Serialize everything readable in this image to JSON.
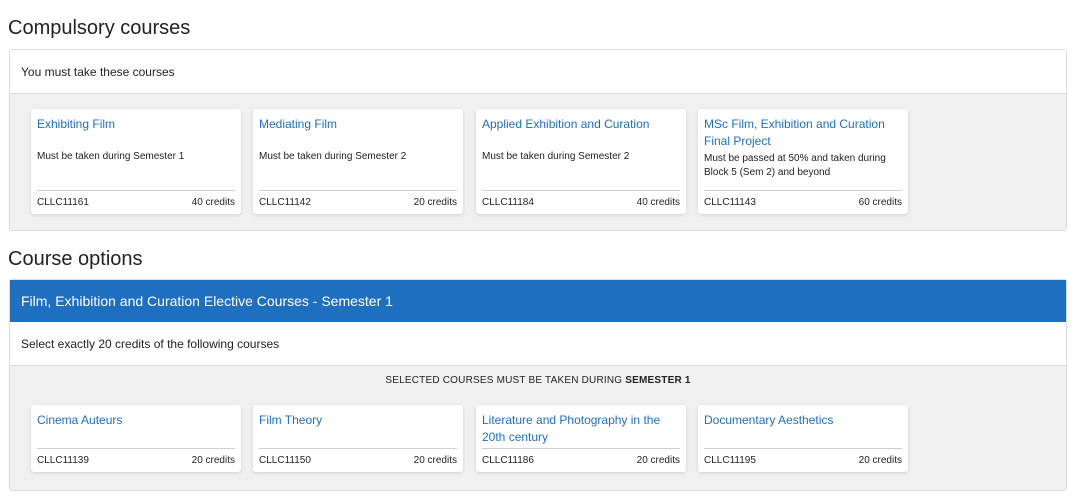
{
  "compulsory": {
    "title": "Compulsory courses",
    "subtitle": "You must take these courses",
    "courses": [
      {
        "title": "Exhibiting Film",
        "desc": "Must be taken during Semester 1",
        "code": "CLLC11161",
        "credits": "40 credits"
      },
      {
        "title": "Mediating Film",
        "desc": "Must be taken during Semester 2",
        "code": "CLLC11142",
        "credits": "20 credits"
      },
      {
        "title": "Applied Exhibition and Curation",
        "desc": "Must be taken during Semester 2",
        "code": "CLLC11184",
        "credits": "40 credits"
      },
      {
        "title": "MSc Film, Exhibition and Curation Final Project",
        "desc": "Must be passed at 50% and taken during Block 5 (Sem 2) and beyond",
        "code": "CLLC11143",
        "credits": "60 credits"
      }
    ]
  },
  "options": {
    "title": "Course options",
    "group_title": "Film, Exhibition and Curation Elective Courses - Semester 1",
    "instruction": "Select exactly 20 credits of the following courses",
    "note_prefix": "SELECTED COURSES MUST BE TAKEN DURING",
    "note_bold": "SEMESTER 1",
    "courses": [
      {
        "title": "Cinema Auteurs",
        "code": "CLLC11139",
        "credits": "20 credits"
      },
      {
        "title": "Film Theory",
        "code": "CLLC11150",
        "credits": "20 credits"
      },
      {
        "title": "Literature and Photography in the 20th century",
        "code": "CLLC11186",
        "credits": "20 credits"
      },
      {
        "title": "Documentary Aesthetics",
        "code": "CLLC11195",
        "credits": "20 credits"
      }
    ]
  }
}
